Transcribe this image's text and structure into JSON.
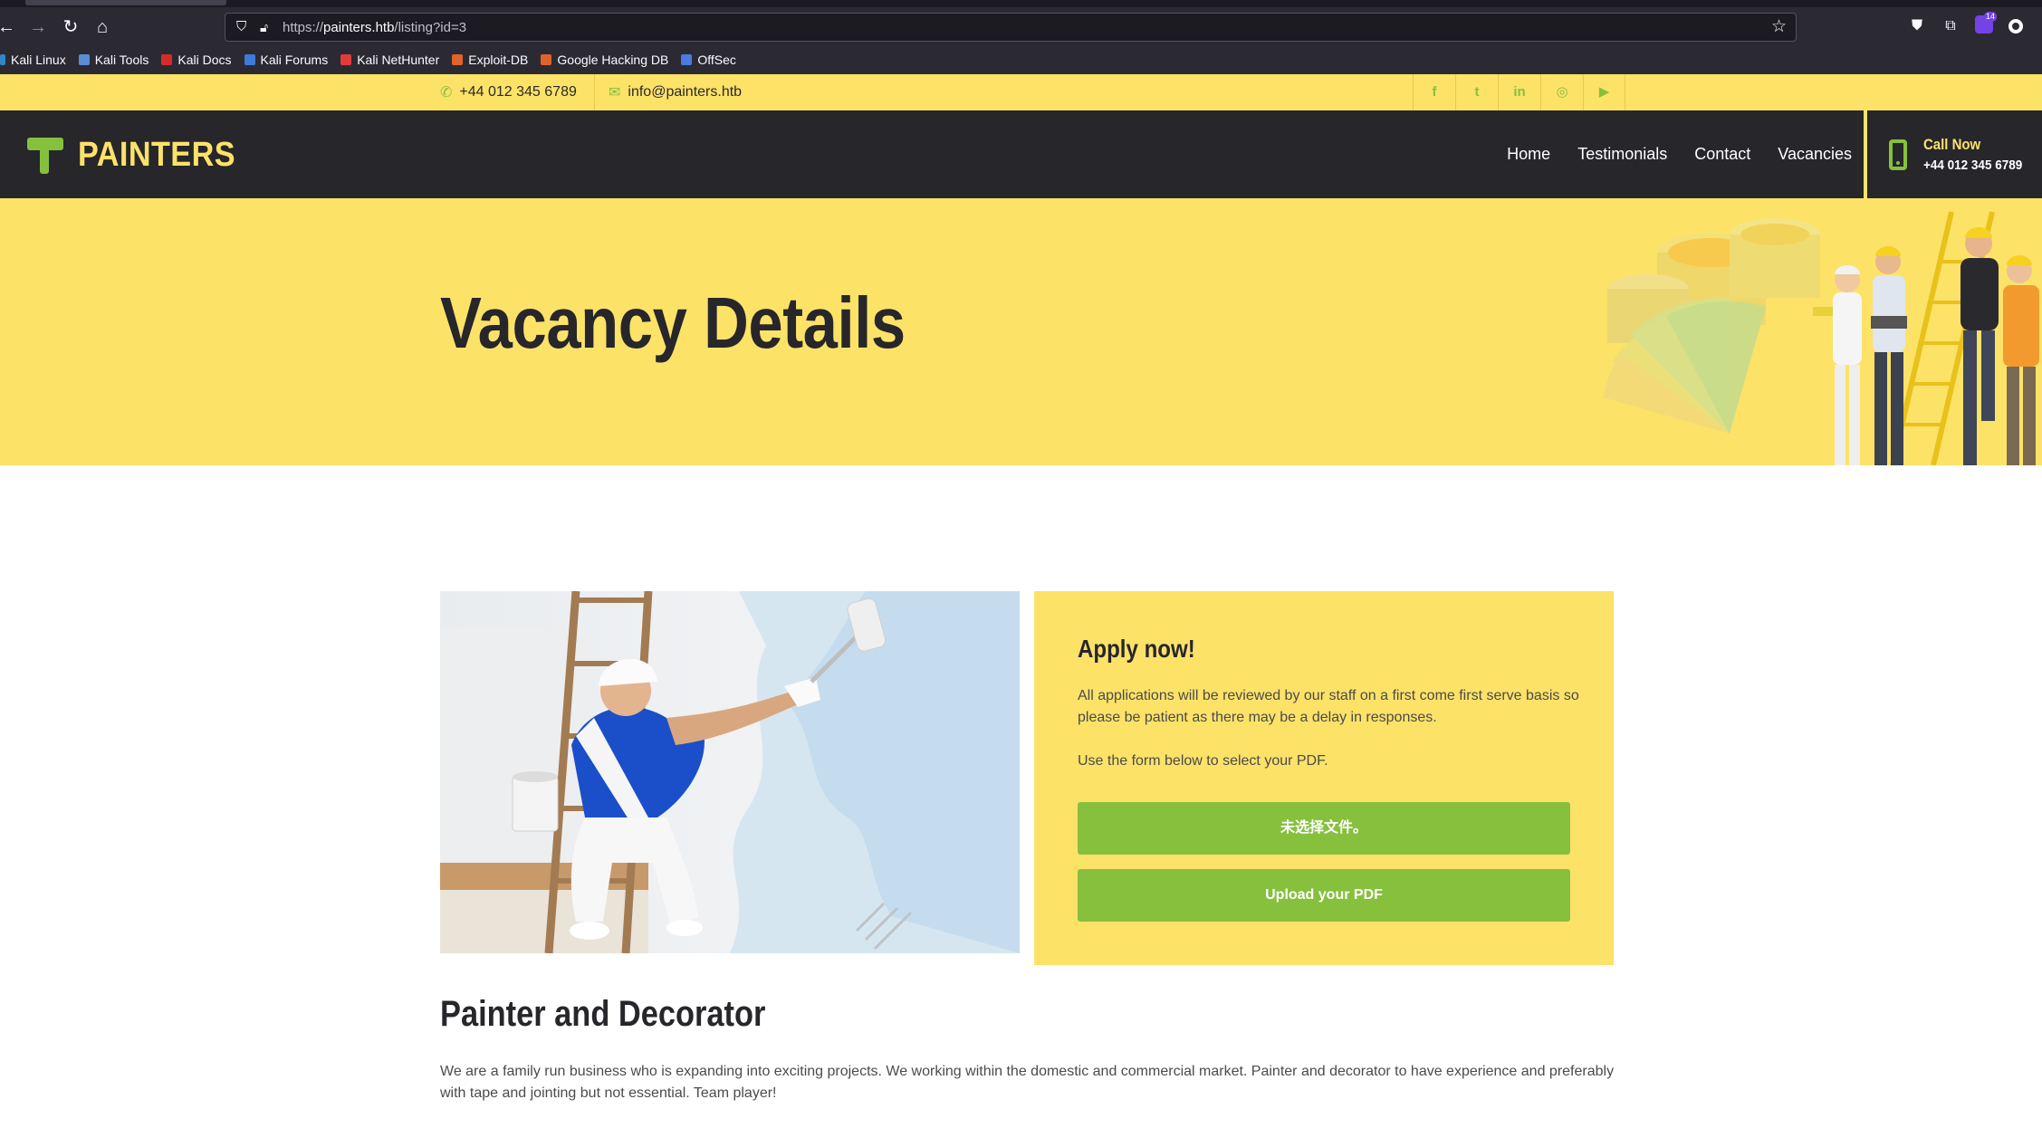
{
  "browser": {
    "url_prefix": "https://",
    "url_host": "painters.htb",
    "url_path": "/listing?id=3",
    "badge_count": "14",
    "bookmarks": [
      {
        "label": "Kali Linux",
        "color": "#2f87c9"
      },
      {
        "label": "Kali Tools",
        "color": "#5b8cd6"
      },
      {
        "label": "Kali Docs",
        "color": "#d62b2b"
      },
      {
        "label": "Kali Forums",
        "color": "#3d7bd8"
      },
      {
        "label": "Kali NetHunter",
        "color": "#e33b3b"
      },
      {
        "label": "Exploit-DB",
        "color": "#e0632a"
      },
      {
        "label": "Google Hacking DB",
        "color": "#e0632a"
      },
      {
        "label": "OffSec",
        "color": "#4a7be0"
      }
    ]
  },
  "topbar": {
    "phone": "+44 012 345 6789",
    "email": "info@painters.htb",
    "socials": [
      {
        "icon": "facebook-icon",
        "glyph": "f"
      },
      {
        "icon": "twitter-icon",
        "glyph": "t"
      },
      {
        "icon": "linkedin-icon",
        "glyph": "in"
      },
      {
        "icon": "instagram-icon",
        "glyph": "◎"
      },
      {
        "icon": "youtube-icon",
        "glyph": "▶"
      }
    ]
  },
  "navbar": {
    "brand": "PAINTERS",
    "menu": [
      "Home",
      "Testimonials",
      "Contact",
      "Vacancies"
    ],
    "call_label": "Call Now",
    "call_number": "+44 012 345 6789"
  },
  "hero": {
    "title": "Vacancy Details"
  },
  "apply": {
    "title": "Apply now!",
    "text1": "All applications will be reviewed by our staff on a first come first serve basis so please be patient as there may be a delay in responses.",
    "text2": "Use the form below to select your PDF.",
    "file_button": "未选择文件。",
    "upload_button": "Upload your PDF"
  },
  "job": {
    "title": "Painter and Decorator",
    "description": "We are a family run business who is expanding into exciting projects. We working within the domestic and commercial market. Painter and decorator to have experience and preferably with tape and jointing but not essential. Team player!"
  },
  "colors": {
    "accent_yellow": "#fde268",
    "accent_green": "#86c03d",
    "dark": "#26262b"
  }
}
